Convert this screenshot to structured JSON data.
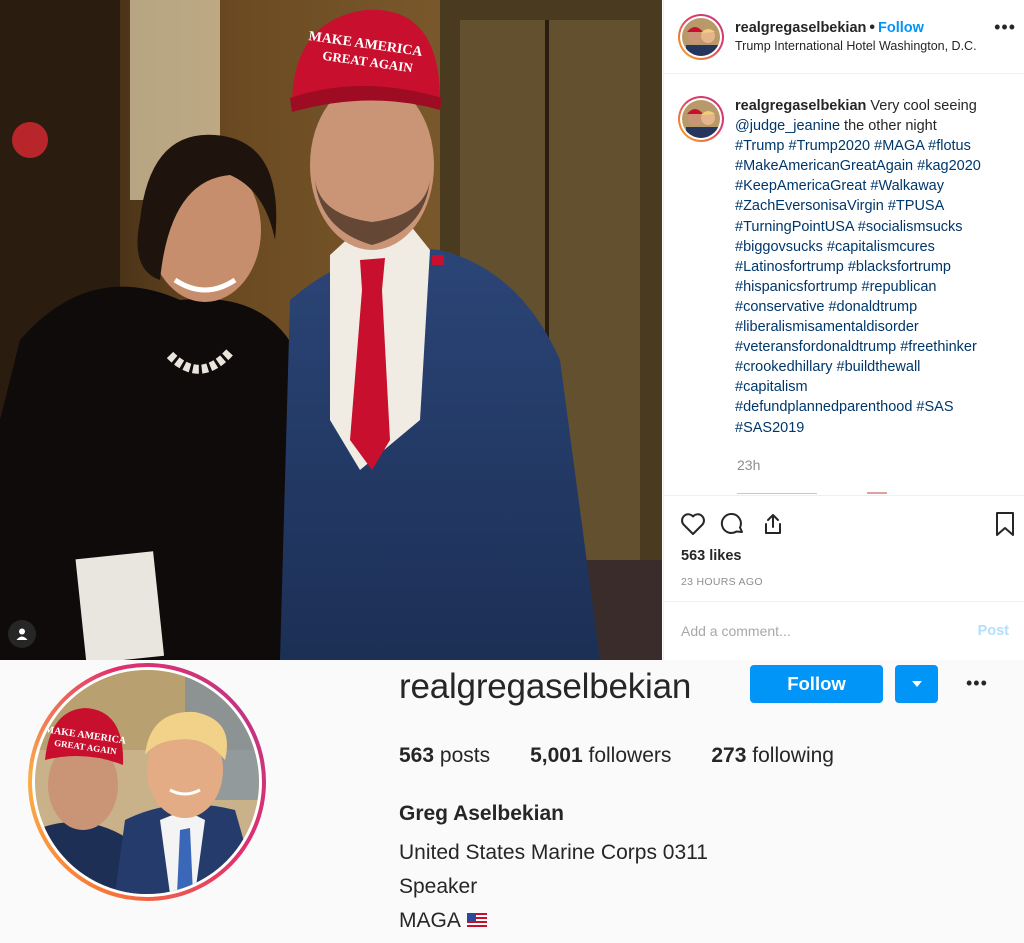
{
  "post": {
    "username": "realgregaselbekian",
    "separator": "•",
    "follow_label": "Follow",
    "location": "Trump International Hotel Washington, D.C.",
    "more_label": "•••",
    "caption_lines": [
      {
        "text": "Very cool seeing",
        "tag": false,
        "lead": true
      },
      {
        "text": "@judge_jeanine",
        "tag": true,
        "rest": " the other night"
      },
      {
        "text": "#Trump #Trump2020 #MAGA #flotus",
        "tag": true
      },
      {
        "text": "#MakeAmericanGreatAgain #kag2020",
        "tag": true
      },
      {
        "text": "#KeepAmericaGreat #Walkaway",
        "tag": true
      },
      {
        "text": "#ZachEversonisaVirgin #TPUSA",
        "tag": true
      },
      {
        "text": "#TurningPointUSA #socialismsucks",
        "tag": true
      },
      {
        "text": "#biggovsucks #capitalismcures",
        "tag": true
      },
      {
        "text": "#Latinosfortrump #blacksfortrump",
        "tag": true
      },
      {
        "text": "#hispanicsfortrump #republican",
        "tag": true
      },
      {
        "text": "#conservative #donaldtrump",
        "tag": true
      },
      {
        "text": "#liberalismisamentaldisorder",
        "tag": true
      },
      {
        "text": "#veteransfordonaldtrump #freethinker",
        "tag": true
      },
      {
        "text": "#crookedhillary #buildthewall",
        "tag": true
      },
      {
        "text": "#capitalism",
        "tag": true
      },
      {
        "text": "#defundplannedparenthood #SAS",
        "tag": true
      },
      {
        "text": "#SAS2019",
        "tag": true
      }
    ],
    "caption_time": "23h",
    "likes": "563 likes",
    "time_ago": "23 HOURS AGO",
    "comment_placeholder": "Add a comment...",
    "post_label": "Post"
  },
  "profile": {
    "username": "realgregaselbekian",
    "follow_label": "Follow",
    "more_label": "•••",
    "posts_count": "563",
    "posts_label": "posts",
    "followers_count": "5,001",
    "followers_label": "followers",
    "following_count": "273",
    "following_label": "following",
    "full_name": "Greg Aselbekian",
    "bio_line1": "United States Marine Corps 0311",
    "bio_line2": "Speaker",
    "bio_line3": "MAGA"
  },
  "colors": {
    "accent": "#0095f6",
    "hashtag": "#00376b",
    "muted": "#8e8e8e",
    "hat_red": "#c8102e"
  },
  "icons": [
    "heart-icon",
    "comment-icon",
    "share-icon",
    "bookmark-icon",
    "user-tag-icon",
    "chevron-down-icon",
    "us-flag-icon"
  ]
}
